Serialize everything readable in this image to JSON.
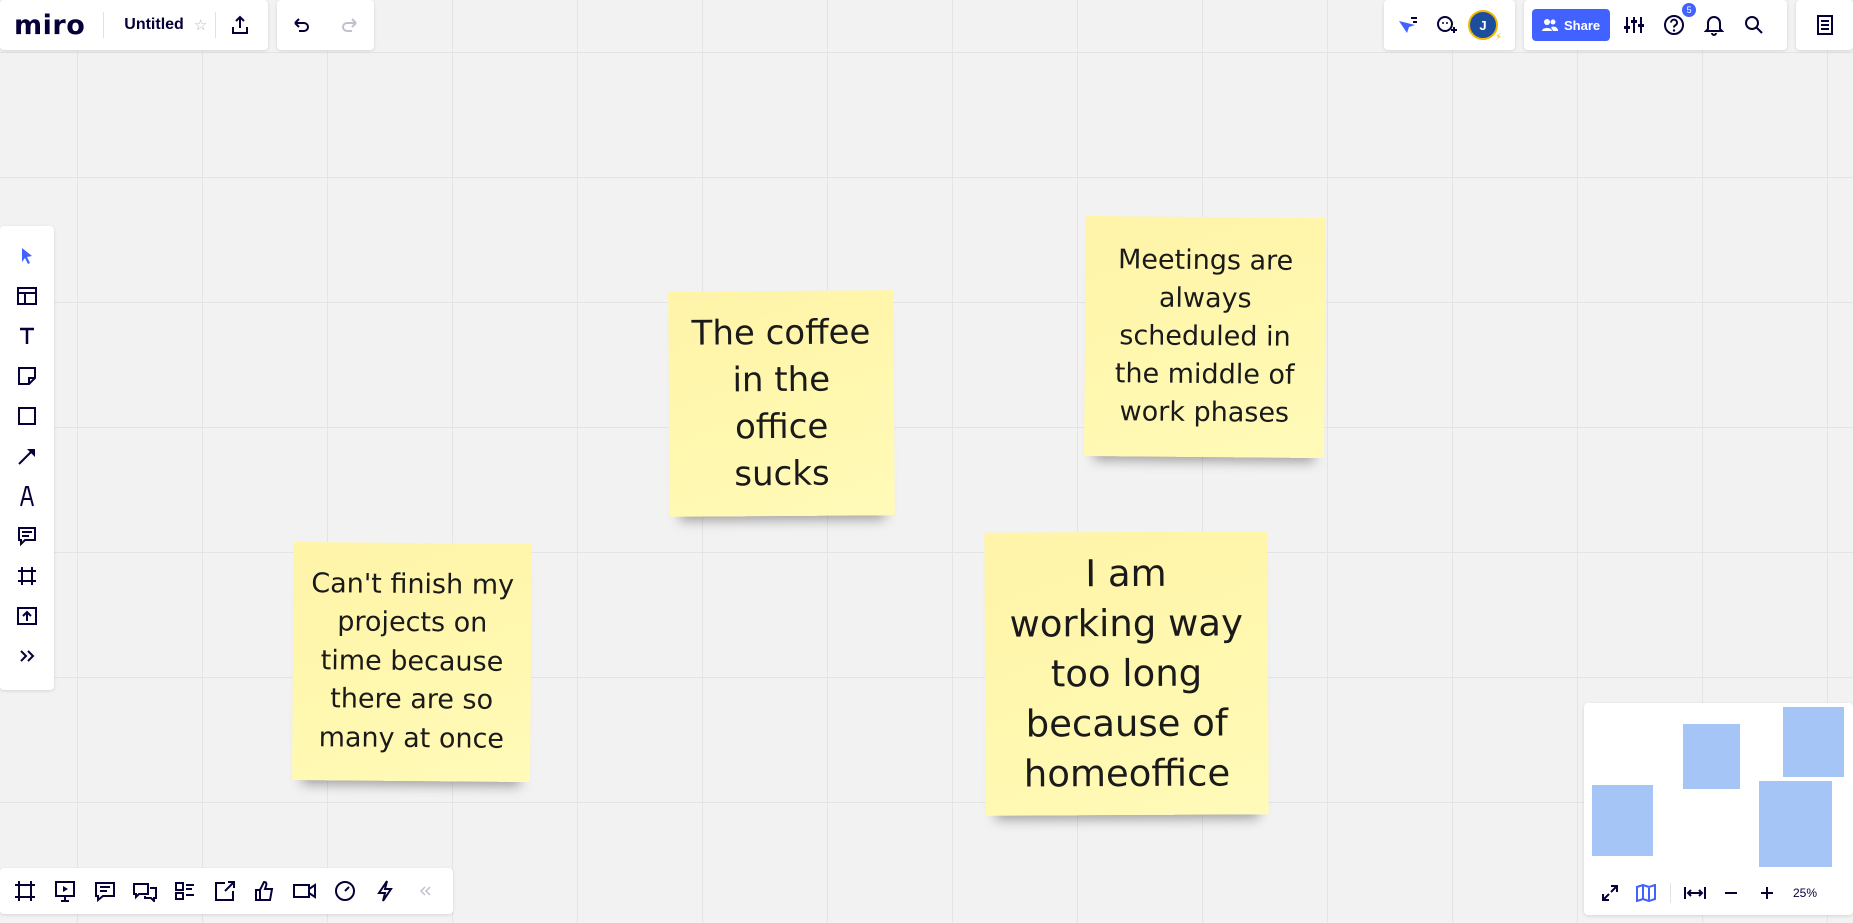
{
  "app": {
    "logo": "miro",
    "board_title": "Untitled"
  },
  "header": {
    "share_label": "Share",
    "notifications_count": "5",
    "avatar_initial": "J"
  },
  "stickies": [
    {
      "text": "The coffee in the office sucks"
    },
    {
      "text": "Meetings are always scheduled in the middle of work phases"
    },
    {
      "text": "Can't finish my projects on time because there are so many at once"
    },
    {
      "text": "I am working way too long because of homeoffice"
    }
  ],
  "zoom": {
    "level": "25%"
  },
  "icons": {
    "left_toolbar": [
      "select-cursor-icon",
      "templates-icon",
      "text-icon",
      "sticky-note-icon",
      "shape-icon",
      "arrow-line-icon",
      "pen-icon",
      "comment-icon",
      "frame-icon",
      "upload-icon",
      "more-tools-icon"
    ],
    "bottom_toolbar": [
      "frames-icon",
      "presentation-icon",
      "comments-icon",
      "chat-icon",
      "cards-icon",
      "share-screen-icon",
      "voting-icon",
      "video-call-icon",
      "timer-icon",
      "activity-icon",
      "collapse-icon"
    ]
  },
  "colors": {
    "accent": "#4262ff",
    "sticky": "#fff6a8",
    "minimap_item": "#a6c5f7"
  }
}
